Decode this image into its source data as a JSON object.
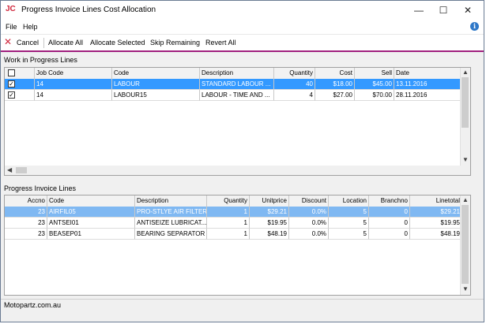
{
  "window": {
    "app_icon": "JC",
    "title": "Progress Invoice Lines Cost Allocation",
    "minimize": "—",
    "maximize": "☐",
    "close": "✕"
  },
  "menu": {
    "file": "File",
    "help": "Help"
  },
  "help_icon": "i",
  "toolbar": {
    "cancel_icon": "✕",
    "cancel": "Cancel",
    "allocate_all": "Allocate All",
    "allocate_selected": "Allocate Selected",
    "skip_remaining": "Skip Remaining",
    "revert_all": "Revert All"
  },
  "wip": {
    "label": "Work in Progress Lines",
    "columns": [
      "",
      "Job Code",
      "Code",
      "Description",
      "Quantity",
      "Cost",
      "Sell",
      "Date"
    ],
    "rows": [
      {
        "checked": "✓",
        "job_code": "14",
        "code": "LABOUR",
        "description": "STANDARD LABOUR ...",
        "quantity": "40",
        "cost": "$18.00",
        "sell": "$45.00",
        "date": "13.11.2016"
      },
      {
        "checked": "✓",
        "job_code": "14",
        "code": "LABOUR15",
        "description": "LABOUR - TIME AND ...",
        "quantity": "4",
        "cost": "$27.00",
        "sell": "$70.00",
        "date": "28.11.2016"
      }
    ]
  },
  "pil": {
    "label": "Progress Invoice Lines",
    "columns": [
      "Accno",
      "Code",
      "Description",
      "Quantity",
      "Unitprice",
      "Discount",
      "Location",
      "Branchno",
      "Linetotal"
    ],
    "rows": [
      {
        "accno": "23",
        "code": "AIRFIL05",
        "description": "PRO-STLYE AIR FILTER",
        "quantity": "1",
        "unitprice": "$29.21",
        "discount": "0.0%",
        "location": "5",
        "branchno": "0",
        "linetotal": "$29.21"
      },
      {
        "accno": "23",
        "code": "ANTSEI01",
        "description": "ANTISEIZE LUBRICAT...",
        "quantity": "1",
        "unitprice": "$19.95",
        "discount": "0.0%",
        "location": "5",
        "branchno": "0",
        "linetotal": "$19.95"
      },
      {
        "accno": "23",
        "code": "BEASEP01",
        "description": "BEARING SEPARATOR",
        "quantity": "1",
        "unitprice": "$48.19",
        "discount": "0.0%",
        "location": "5",
        "branchno": "0",
        "linetotal": "$48.19"
      }
    ]
  },
  "status": "Motopartz.com.au",
  "icons": {
    "cancel": "cancel-icon",
    "help": "info-icon",
    "checkbox": "checkbox-icon"
  },
  "colors": {
    "accent": "#a0207e",
    "selection": "#3399ff",
    "app_icon": "#d0263c"
  }
}
